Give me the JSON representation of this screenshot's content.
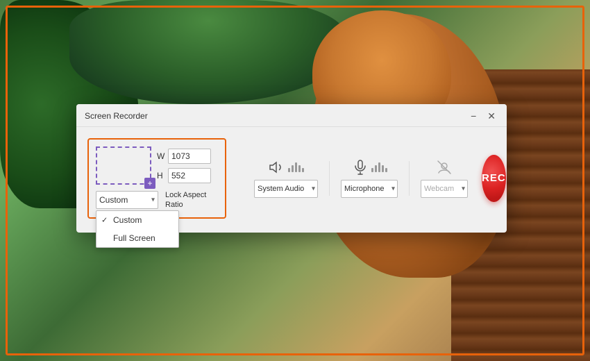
{
  "window": {
    "title": "Screen Recorder",
    "minimize_label": "−",
    "close_label": "✕"
  },
  "region": {
    "w_label": "W",
    "h_label": "H",
    "w_value": "1073",
    "h_value": "552",
    "dropdown_value": "Custom",
    "dropdown_options": [
      "Custom",
      "Full Screen"
    ],
    "lock_label": "Lock Aspect\nRatio"
  },
  "dropdown_menu": {
    "items": [
      {
        "label": "Custom",
        "checked": true
      },
      {
        "label": "Full Screen",
        "checked": false
      }
    ]
  },
  "audio": {
    "system_label": "System Audio",
    "mic_label": "Microphone",
    "webcam_label": "Webcam"
  },
  "rec_button": {
    "label": "REC"
  }
}
